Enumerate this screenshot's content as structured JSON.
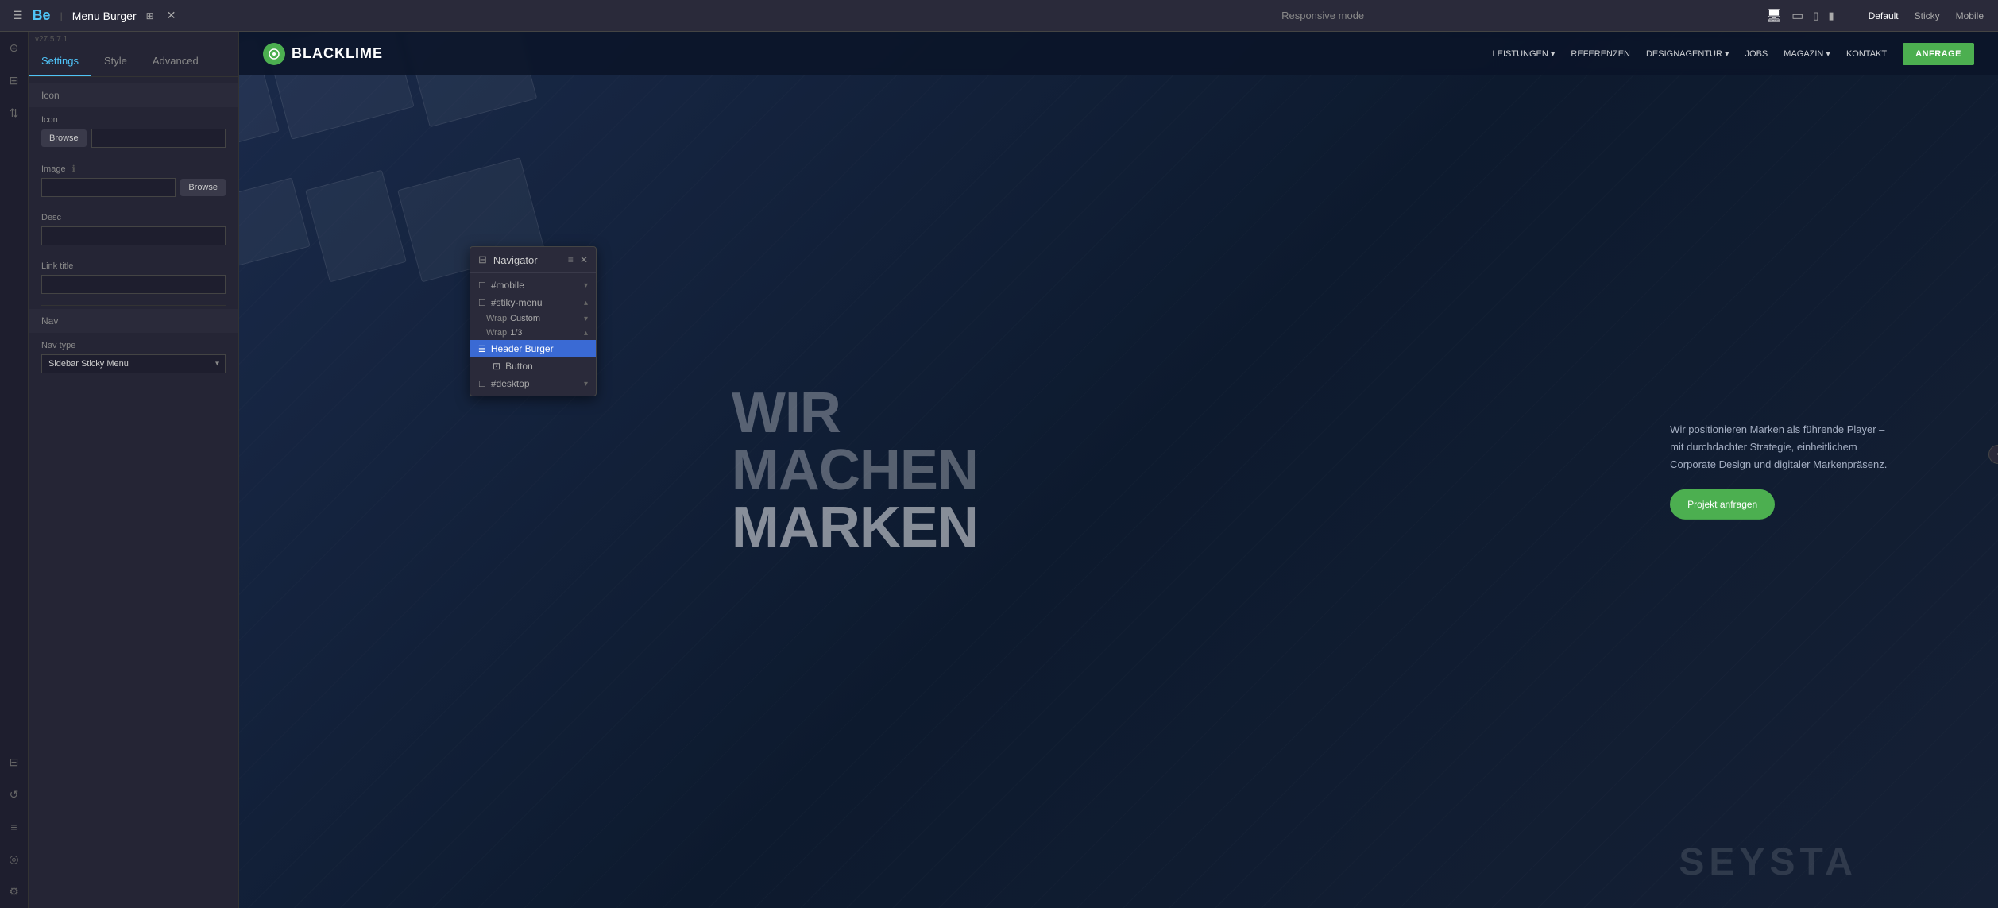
{
  "app": {
    "logo": "Be",
    "title": "Menu Burger",
    "version": "v27.5.7.1",
    "responsive_mode": "Responsive mode"
  },
  "topbar": {
    "view_modes": [
      "Default",
      "Sticky",
      "Mobile"
    ],
    "active_view": "Default"
  },
  "tabs": [
    {
      "label": "Settings",
      "active": true
    },
    {
      "label": "Style",
      "active": false
    },
    {
      "label": "Advanced",
      "active": false
    }
  ],
  "sections": {
    "icon_section": "Icon",
    "nav_section": "Nav"
  },
  "fields": {
    "icon_label": "Icon",
    "browse_label": "Browse",
    "image_label": "Image",
    "desc_label": "Desc",
    "link_title_label": "Link title",
    "nav_type_label": "Nav type",
    "nav_type_value": "Sidebar Sticky Menu"
  },
  "navigator": {
    "title": "Navigator",
    "items": [
      {
        "id": "mobile",
        "label": "#mobile",
        "indent": 0,
        "arrow": "down"
      },
      {
        "id": "sticky-menu",
        "label": "#stiky-menu",
        "indent": 0,
        "arrow": "up"
      },
      {
        "id": "wrap-custom",
        "label": "Wrap",
        "value": "Custom",
        "indent": 1,
        "arrow": "down"
      },
      {
        "id": "wrap-13",
        "label": "Wrap",
        "value": "1/3",
        "indent": 1,
        "arrow": "up"
      },
      {
        "id": "header-burger",
        "label": "Header Burger",
        "indent": 2,
        "selected": true
      },
      {
        "id": "button",
        "label": "Button",
        "indent": 2
      },
      {
        "id": "desktop",
        "label": "#desktop",
        "indent": 0,
        "arrow": "down"
      }
    ]
  },
  "site": {
    "logo_text": "BLACKLIME",
    "nav_items": [
      "LEISTUNGEN ▾",
      "REFERENZEN",
      "DESIGNAGENTUR ▾",
      "JOBS",
      "MAGAZIN ▾",
      "KONTAKT"
    ],
    "cta_button": "ANFRAGE",
    "hero_lines": [
      "WIR",
      "MACHEN",
      "MARKEN"
    ],
    "hero_desc": "Wir positionieren Marken als führende Player – mit durchdachter Strategie, einheitlichem Corporate Design und digitaler Markenpräsenz.",
    "hero_cta": "Projekt anfragen",
    "watermark": "SEYSTA"
  },
  "icons": {
    "hamburger": "☰",
    "close": "✕",
    "layers": "⊞",
    "add": "+",
    "arrow_up_down": "⇅",
    "settings": "⚙",
    "grid": "⊡",
    "eye": "👁",
    "share": "⤴",
    "sliders": "≡",
    "globe": "🌐",
    "gear": "⚙",
    "chevron_down": "▾",
    "chevron_up": "▴",
    "monitor": "🖥",
    "tablet": "▭",
    "phone": "📱",
    "list_icon": "≡",
    "nav_icon": "⊞",
    "page_icon": "☐",
    "wrap_icon": "⊟",
    "burger_icon": "☰",
    "btn_icon": "⊡"
  }
}
